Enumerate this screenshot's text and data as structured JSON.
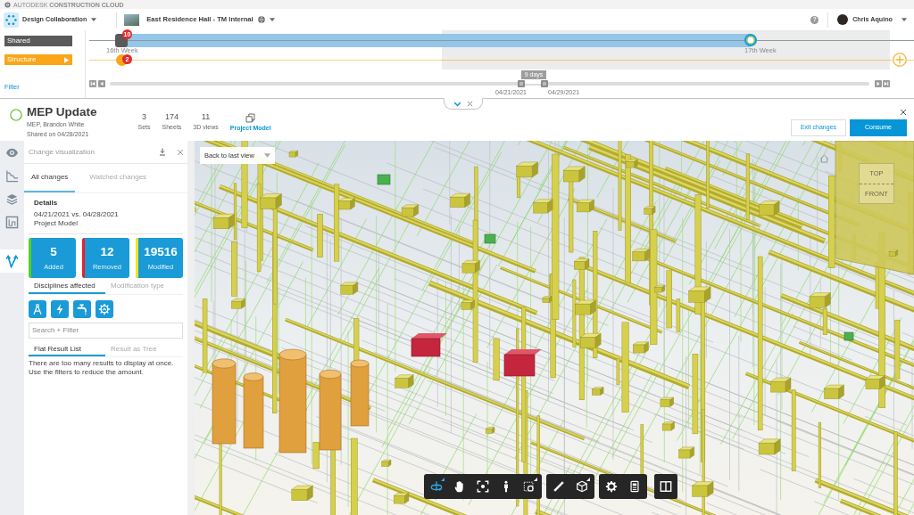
{
  "brand": {
    "text": "AUTODESK **CONSTRUCTION CLOUD**"
  },
  "header": {
    "app": "Design Collaboration",
    "project": "East Residence Hall - TM Internal",
    "help": "?",
    "user": "Chris Aquino"
  },
  "timeline": {
    "tracks": [
      {
        "label": "Shared",
        "kind": "shared",
        "color": "#5a5a5a",
        "markers": [
          {
            "kind": "package",
            "badge": "10",
            "week": "16th Week"
          },
          {
            "kind": "current",
            "week": "17th Week"
          }
        ]
      },
      {
        "label": "Structure",
        "kind": "team",
        "color": "#f9a61a",
        "markers": [
          {
            "kind": "package",
            "badge": "2"
          }
        ]
      }
    ],
    "filter": "Filter",
    "range": {
      "duration": "9 days",
      "start": "04/21/2021",
      "end": "04/29/2021"
    }
  },
  "package": {
    "title": "MEP Update",
    "subtitle": "MEP, Brandon White",
    "shared": "Shared on 04/28/2021",
    "stats": [
      {
        "value": "3",
        "label": "Sets"
      },
      {
        "value": "174",
        "label": "Sheets"
      },
      {
        "value": "11",
        "label": "3D views"
      }
    ],
    "model_link": "Project Model",
    "buttons": [
      {
        "label": "Exit changes",
        "kind": "secondary"
      },
      {
        "label": "Consume",
        "kind": "primary"
      }
    ]
  },
  "rail": [
    {
      "kind": "eye",
      "selected": false
    },
    {
      "kind": "chart",
      "selected": false
    },
    {
      "kind": "layers",
      "selected": false
    },
    {
      "kind": "plan",
      "selected": false
    },
    {
      "kind": "changes",
      "selected": true
    }
  ],
  "panel": {
    "title": "Change visualization",
    "tabs": [
      {
        "label": "All changes",
        "selected": true
      },
      {
        "label": "Watched changes",
        "selected": false
      }
    ],
    "details": {
      "heading": "Details",
      "range": "04/21/2021 vs. 04/28/2021",
      "model": "Project Model"
    },
    "summary": [
      {
        "value": "5",
        "label": "Added",
        "color": "#52d41e"
      },
      {
        "value": "12",
        "label": "Removed",
        "color": "#e8202a"
      },
      {
        "value": "19516",
        "label": "Modified",
        "color": "#f2e51b"
      }
    ],
    "filter_tabs": [
      {
        "label": "Disciplines affected",
        "selected": true
      },
      {
        "label": "Modification type",
        "selected": false
      }
    ],
    "disciplines": [
      {
        "kind": "architecture"
      },
      {
        "kind": "electrical"
      },
      {
        "kind": "plumbing"
      },
      {
        "kind": "mechanical"
      }
    ],
    "search": {
      "placeholder": "Search + Filter"
    },
    "result_tabs": [
      {
        "label": "Flat Result List",
        "selected": true
      },
      {
        "label": "Result as Tree",
        "selected": false
      }
    ],
    "message": "There are too many results to display at once. Use the filters to reduce the amount."
  },
  "viewer": {
    "view_menu": "Back to last view",
    "viewcube": {
      "top": "TOP",
      "front": "FRONT"
    },
    "toolbar": [
      {
        "tools": [
          {
            "kind": "orbit",
            "selected": true,
            "flyout": true
          },
          {
            "kind": "pan",
            "selected": false,
            "flyout": false
          },
          {
            "kind": "fit",
            "selected": false,
            "flyout": false
          },
          {
            "kind": "walk",
            "selected": false,
            "flyout": false
          },
          {
            "kind": "section",
            "selected": false,
            "flyout": true
          }
        ]
      },
      {
        "tools": [
          {
            "kind": "measure",
            "selected": false,
            "flyout": false
          },
          {
            "kind": "explode",
            "selected": false,
            "flyout": true
          }
        ]
      },
      {
        "tools": [
          {
            "kind": "settings",
            "selected": false,
            "flyout": false
          },
          {
            "kind": "properties",
            "selected": false,
            "flyout": false
          }
        ]
      },
      {
        "tools": [
          {
            "kind": "split",
            "selected": false,
            "flyout": false
          }
        ]
      }
    ]
  }
}
